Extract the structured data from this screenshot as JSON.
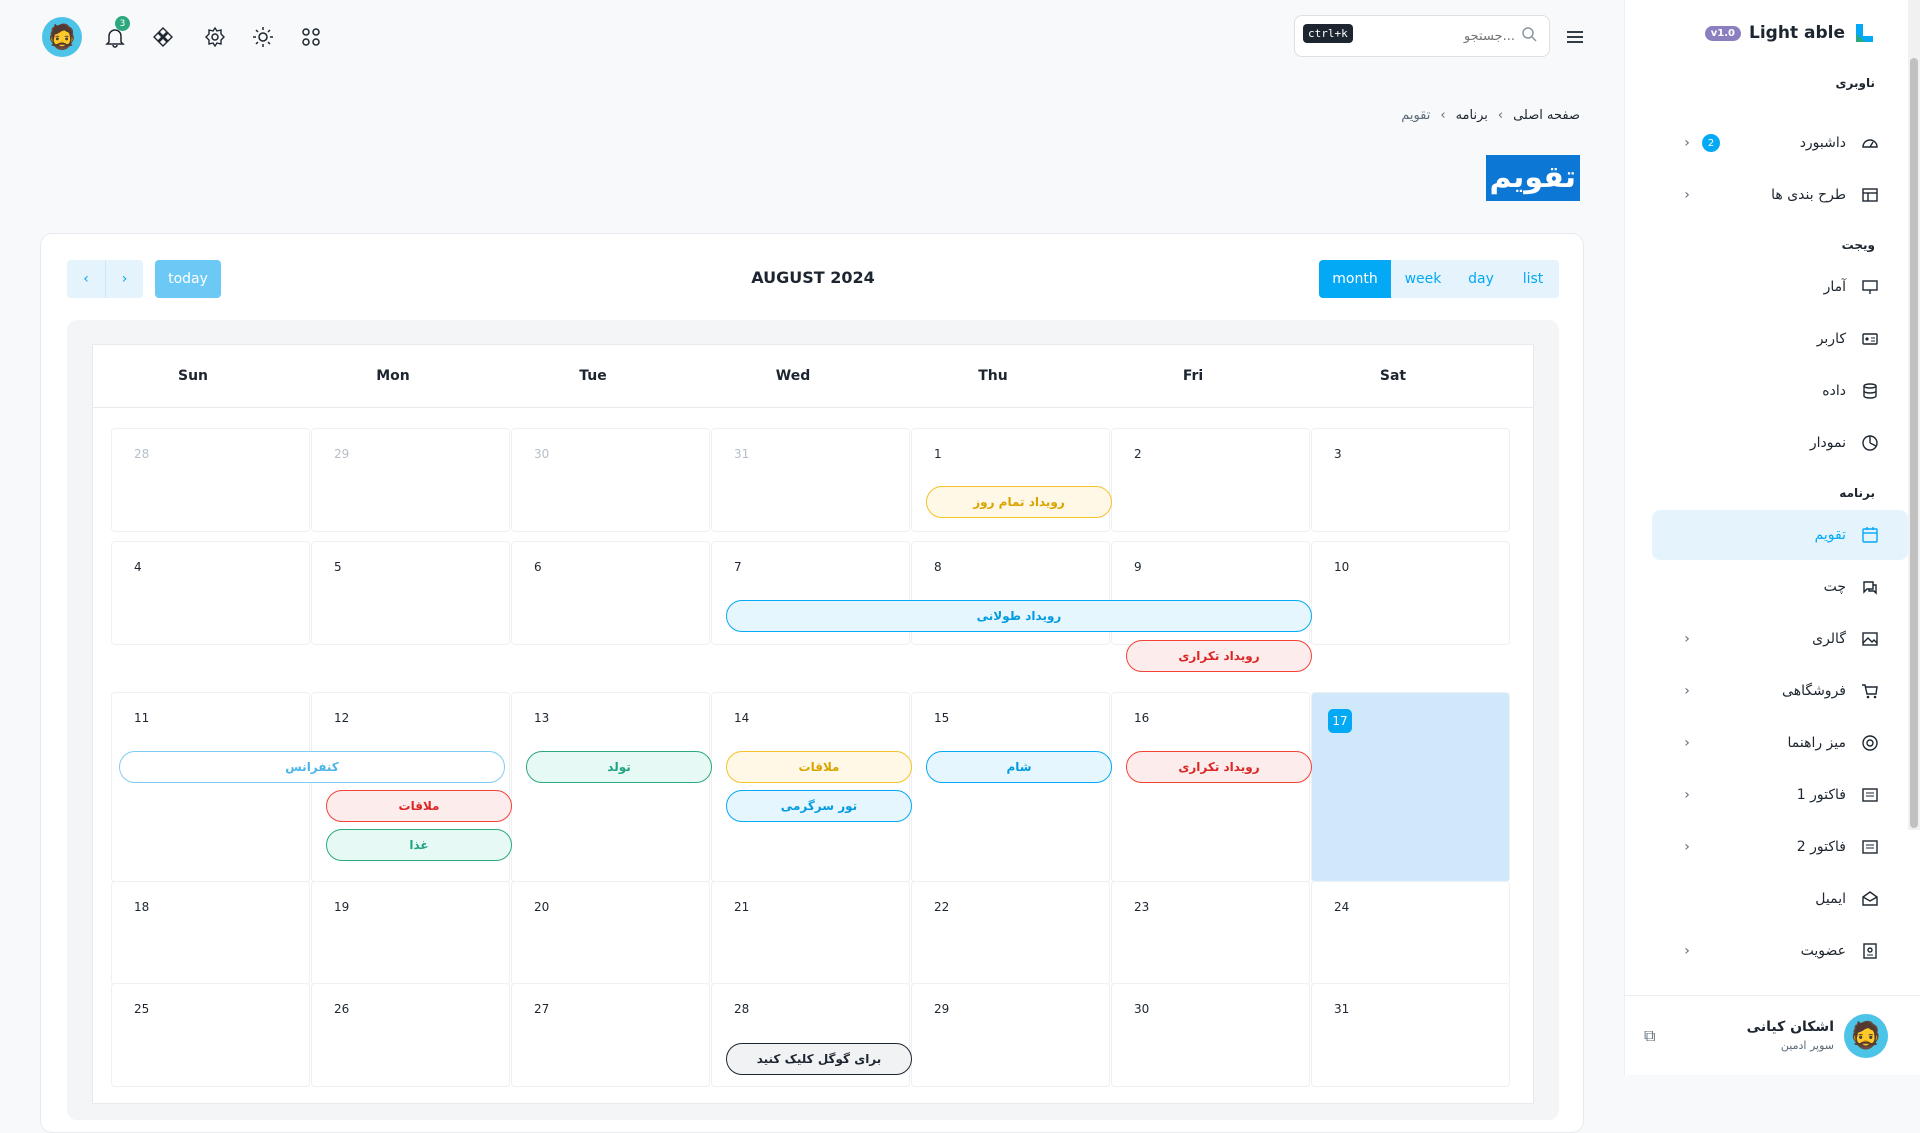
{
  "sidebar": {
    "version": "v1.0",
    "brand": "Light able",
    "sections": {
      "nav": "ناوبری",
      "widget": "ویجت",
      "app": "برنامه"
    },
    "items": [
      {
        "label": "داشبورد",
        "badge": "2"
      },
      {
        "label": "طرح بندی ها"
      },
      {
        "label": "آمار"
      },
      {
        "label": "کاربر"
      },
      {
        "label": "داده"
      },
      {
        "label": "نمودار"
      },
      {
        "label": "تقویم"
      },
      {
        "label": "چت"
      },
      {
        "label": "گالری"
      },
      {
        "label": "فروشگاهی"
      },
      {
        "label": "میز راهنما"
      },
      {
        "label": "فاکتور 1"
      },
      {
        "label": "فاکتور 2"
      },
      {
        "label": "ایمیل"
      },
      {
        "label": "عضویت"
      }
    ],
    "user": {
      "name": "اشکان کیانی",
      "role": "سوپر ادمین"
    }
  },
  "header": {
    "search_placeholder": "جستجو...",
    "shortcut": "ctrl+k",
    "notification_count": "3"
  },
  "breadcrumb": {
    "home": "صفحه اصلی",
    "section": "برنامه",
    "current": "تقویم"
  },
  "page_title": "تقویم",
  "calendar": {
    "title": "AUGUST 2024",
    "today_label": "today",
    "views": [
      "month",
      "week",
      "day",
      "list"
    ],
    "active_view": "month",
    "weekdays": [
      "Sun",
      "Mon",
      "Tue",
      "Wed",
      "Thu",
      "Fri",
      "Sat"
    ],
    "weeks": [
      [
        "28",
        "29",
        "30",
        "31",
        "1",
        "2",
        "3"
      ],
      [
        "4",
        "5",
        "6",
        "7",
        "8",
        "9",
        "10"
      ],
      [
        "11",
        "12",
        "13",
        "14",
        "15",
        "16",
        "17"
      ],
      [
        "18",
        "19",
        "20",
        "21",
        "22",
        "23",
        "24"
      ],
      [
        "25",
        "26",
        "27",
        "28",
        "29",
        "30",
        "31"
      ]
    ],
    "today": "17",
    "events": {
      "all_day": "رویداد تمام روز",
      "long": "رویداد طولانی",
      "repeat1": "رویداد تکراری",
      "conference": "کنفرانس",
      "birthday": "تولد",
      "meeting1": "ملاقات",
      "dinner": "شام",
      "repeat2": "رویداد تکراری",
      "meeting2": "ملاقات",
      "fun_tour": "تور سرگرمی",
      "food": "غذا",
      "google": "برای گوگل کلیک کنید"
    }
  }
}
